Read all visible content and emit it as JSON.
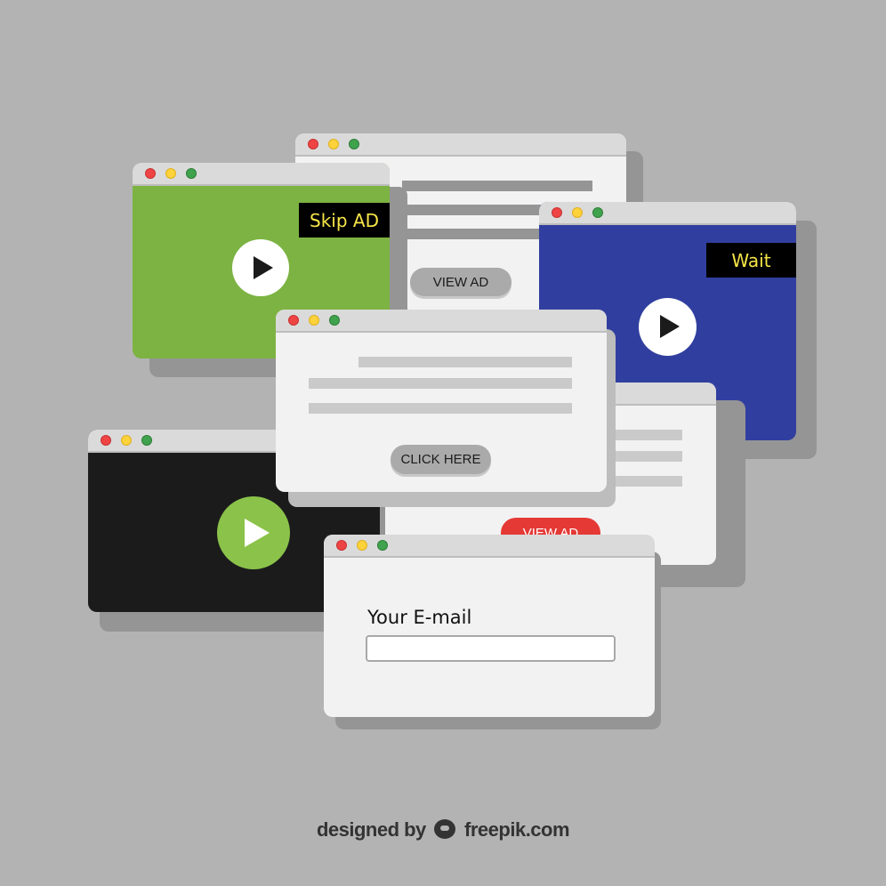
{
  "windows": {
    "green_video": {
      "badge_label": "Skip AD",
      "bg_color": "#7cb342",
      "play_button": "play-icon"
    },
    "top_article": {
      "button_label": "VIEW AD"
    },
    "blue_video": {
      "badge_label": "Wait",
      "bg_color": "#303f9f",
      "play_button": "play-icon"
    },
    "center_popup": {
      "button_label": "CLICK HERE"
    },
    "black_video": {
      "bg_color": "#1b1b1b",
      "play_button": "play-icon",
      "play_color": "#8bc34a"
    },
    "right_popup": {
      "button_label": "VIEW AD",
      "button_color": "#e53935"
    },
    "email_popup": {
      "field_label": "Your E-mail",
      "field_value": "",
      "field_placeholder": ""
    }
  },
  "window_controls": {
    "close": "close-dot",
    "minimize": "minimize-dot",
    "maximize": "maximize-dot"
  },
  "credit": {
    "prefix": "designed by",
    "brand": "freepik.com"
  }
}
